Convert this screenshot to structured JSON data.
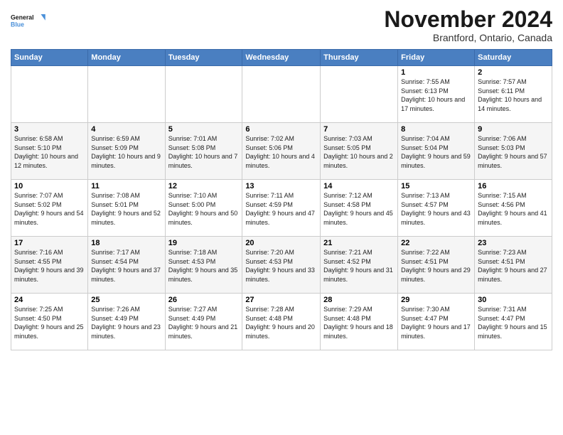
{
  "logo": {
    "line1": "General",
    "line2": "Blue"
  },
  "title": "November 2024",
  "location": "Brantford, Ontario, Canada",
  "days_of_week": [
    "Sunday",
    "Monday",
    "Tuesday",
    "Wednesday",
    "Thursday",
    "Friday",
    "Saturday"
  ],
  "weeks": [
    [
      {
        "day": "",
        "info": ""
      },
      {
        "day": "",
        "info": ""
      },
      {
        "day": "",
        "info": ""
      },
      {
        "day": "",
        "info": ""
      },
      {
        "day": "",
        "info": ""
      },
      {
        "day": "1",
        "info": "Sunrise: 7:55 AM\nSunset: 6:13 PM\nDaylight: 10 hours and 17 minutes."
      },
      {
        "day": "2",
        "info": "Sunrise: 7:57 AM\nSunset: 6:11 PM\nDaylight: 10 hours and 14 minutes."
      }
    ],
    [
      {
        "day": "3",
        "info": "Sunrise: 6:58 AM\nSunset: 5:10 PM\nDaylight: 10 hours and 12 minutes."
      },
      {
        "day": "4",
        "info": "Sunrise: 6:59 AM\nSunset: 5:09 PM\nDaylight: 10 hours and 9 minutes."
      },
      {
        "day": "5",
        "info": "Sunrise: 7:01 AM\nSunset: 5:08 PM\nDaylight: 10 hours and 7 minutes."
      },
      {
        "day": "6",
        "info": "Sunrise: 7:02 AM\nSunset: 5:06 PM\nDaylight: 10 hours and 4 minutes."
      },
      {
        "day": "7",
        "info": "Sunrise: 7:03 AM\nSunset: 5:05 PM\nDaylight: 10 hours and 2 minutes."
      },
      {
        "day": "8",
        "info": "Sunrise: 7:04 AM\nSunset: 5:04 PM\nDaylight: 9 hours and 59 minutes."
      },
      {
        "day": "9",
        "info": "Sunrise: 7:06 AM\nSunset: 5:03 PM\nDaylight: 9 hours and 57 minutes."
      }
    ],
    [
      {
        "day": "10",
        "info": "Sunrise: 7:07 AM\nSunset: 5:02 PM\nDaylight: 9 hours and 54 minutes."
      },
      {
        "day": "11",
        "info": "Sunrise: 7:08 AM\nSunset: 5:01 PM\nDaylight: 9 hours and 52 minutes."
      },
      {
        "day": "12",
        "info": "Sunrise: 7:10 AM\nSunset: 5:00 PM\nDaylight: 9 hours and 50 minutes."
      },
      {
        "day": "13",
        "info": "Sunrise: 7:11 AM\nSunset: 4:59 PM\nDaylight: 9 hours and 47 minutes."
      },
      {
        "day": "14",
        "info": "Sunrise: 7:12 AM\nSunset: 4:58 PM\nDaylight: 9 hours and 45 minutes."
      },
      {
        "day": "15",
        "info": "Sunrise: 7:13 AM\nSunset: 4:57 PM\nDaylight: 9 hours and 43 minutes."
      },
      {
        "day": "16",
        "info": "Sunrise: 7:15 AM\nSunset: 4:56 PM\nDaylight: 9 hours and 41 minutes."
      }
    ],
    [
      {
        "day": "17",
        "info": "Sunrise: 7:16 AM\nSunset: 4:55 PM\nDaylight: 9 hours and 39 minutes."
      },
      {
        "day": "18",
        "info": "Sunrise: 7:17 AM\nSunset: 4:54 PM\nDaylight: 9 hours and 37 minutes."
      },
      {
        "day": "19",
        "info": "Sunrise: 7:18 AM\nSunset: 4:53 PM\nDaylight: 9 hours and 35 minutes."
      },
      {
        "day": "20",
        "info": "Sunrise: 7:20 AM\nSunset: 4:53 PM\nDaylight: 9 hours and 33 minutes."
      },
      {
        "day": "21",
        "info": "Sunrise: 7:21 AM\nSunset: 4:52 PM\nDaylight: 9 hours and 31 minutes."
      },
      {
        "day": "22",
        "info": "Sunrise: 7:22 AM\nSunset: 4:51 PM\nDaylight: 9 hours and 29 minutes."
      },
      {
        "day": "23",
        "info": "Sunrise: 7:23 AM\nSunset: 4:51 PM\nDaylight: 9 hours and 27 minutes."
      }
    ],
    [
      {
        "day": "24",
        "info": "Sunrise: 7:25 AM\nSunset: 4:50 PM\nDaylight: 9 hours and 25 minutes."
      },
      {
        "day": "25",
        "info": "Sunrise: 7:26 AM\nSunset: 4:49 PM\nDaylight: 9 hours and 23 minutes."
      },
      {
        "day": "26",
        "info": "Sunrise: 7:27 AM\nSunset: 4:49 PM\nDaylight: 9 hours and 21 minutes."
      },
      {
        "day": "27",
        "info": "Sunrise: 7:28 AM\nSunset: 4:48 PM\nDaylight: 9 hours and 20 minutes."
      },
      {
        "day": "28",
        "info": "Sunrise: 7:29 AM\nSunset: 4:48 PM\nDaylight: 9 hours and 18 minutes."
      },
      {
        "day": "29",
        "info": "Sunrise: 7:30 AM\nSunset: 4:47 PM\nDaylight: 9 hours and 17 minutes."
      },
      {
        "day": "30",
        "info": "Sunrise: 7:31 AM\nSunset: 4:47 PM\nDaylight: 9 hours and 15 minutes."
      }
    ]
  ]
}
